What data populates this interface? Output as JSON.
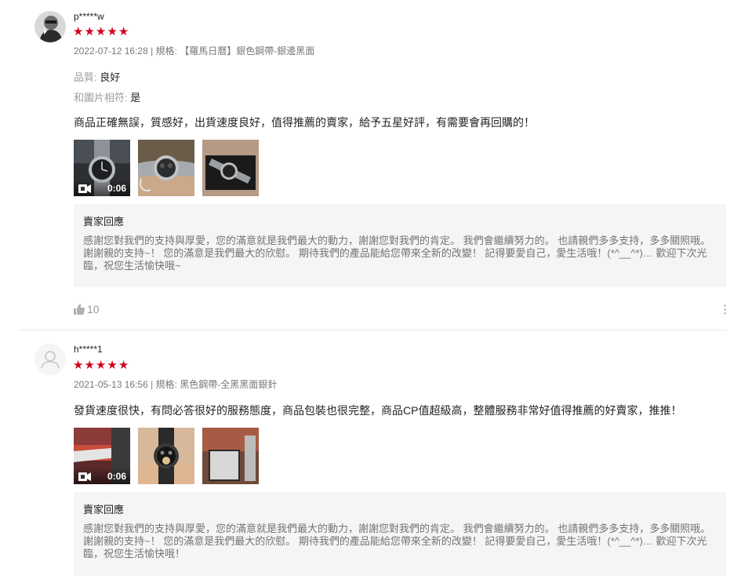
{
  "reviews": [
    {
      "username": "p*****w",
      "rating": 5,
      "date": "2022-07-12 16:28",
      "variation_sep": " | ",
      "variation_label": "規格:",
      "variation_value": "【羅馬日曆】銀色鋼帶-銀邊黑面",
      "attributes": [
        {
          "label": "品質:",
          "value": "良好"
        },
        {
          "label": "和圖片相符:",
          "value": "是"
        }
      ],
      "comment": "商品正確無誤，質感好，出貨速度良好，值得推薦的賣家，給予五星好評，有需要會再回購的！",
      "media": [
        {
          "type": "video",
          "duration": "0:06"
        },
        {
          "type": "image"
        },
        {
          "type": "image"
        }
      ],
      "seller_reply_title": "賣家回應",
      "seller_reply": "感謝您對我們的支持與厚愛，您的滿意就是我們最大的動力，謝謝您對我們的肯定。 我們會繼續努力的。 也請親們多多支持，多多關照哦。 謝謝親的支持~！ 您的滿意是我們最大的欣慰。 期待我們的產品能給您帶來全新的改變！ 記得要愛自己，愛生活哦！(*^__^*)… 歡迎下次光臨，祝您生活愉快哦~",
      "likes": "10"
    },
    {
      "username": "h*****1",
      "rating": 5,
      "date": "2021-05-13 16:56",
      "variation_sep": " | ",
      "variation_label": "規格:",
      "variation_value": "黑色鋼帶-全黑黑面銀針",
      "comment": "發貨速度很快，有問必答很好的服務態度，商品包裝也很完整，商品CP值超級高，整體服務非常好值得推薦的好賣家，推推！",
      "media": [
        {
          "type": "video",
          "duration": "0:06"
        },
        {
          "type": "image"
        },
        {
          "type": "image"
        }
      ],
      "seller_reply_title": "賣家回應",
      "seller_reply": "感謝您對我們的支持與厚愛，您的滿意就是我們最大的動力，謝謝您對我們的肯定。 我們會繼續努力的。 也請親們多多支持，多多關照哦。 謝謝親的支持~！ 您的滿意是我們最大的欣慰。 期待我們的產品能給您帶來全新的改變！ 記得要愛自己，愛生活哦！(*^__^*)… 歡迎下次光臨，祝您生活愉快哦！"
    }
  ],
  "icons": {
    "star": "★",
    "like": "thumbs-up-icon",
    "more": "more-vertical-icon",
    "video": "video-camera-icon"
  },
  "colors": {
    "star": "#d0011b",
    "reply_bg": "#f5f5f5"
  }
}
